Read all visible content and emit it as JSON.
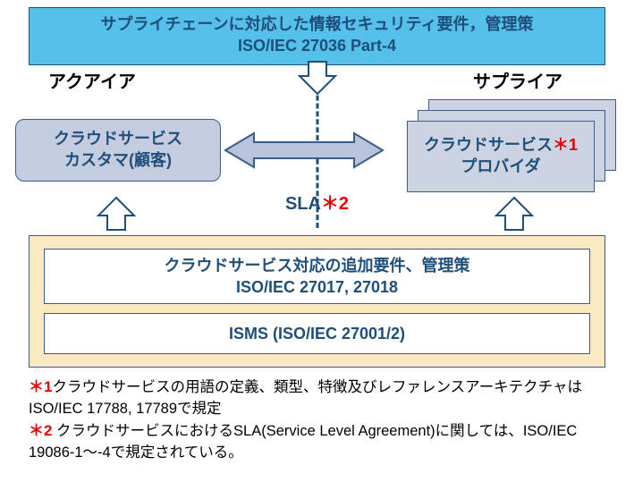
{
  "top": {
    "line1": "サプライチェーンに対応した情報セキュリティ要件，管理策",
    "line2": "ISO/IEC 27036 Part-4"
  },
  "roles": {
    "acquirer": "アクアイア",
    "supplier": "サプライア"
  },
  "customer": {
    "line1": "クラウドサービス",
    "line2": "カスタマ(顧客)"
  },
  "provider": {
    "line1_pre": "クラウドサービス",
    "ast1": "＊1",
    "line2": "プロバイダ"
  },
  "sla": {
    "label": "SLA",
    "ast2": "＊2"
  },
  "bottom": {
    "box1_line1": "クラウドサービス対応の追加要件、管理策",
    "box1_line2": "ISO/IEC 27017, 27018",
    "box2": "ISMS (ISO/IEC 27001/2)"
  },
  "footnotes": {
    "n1_marker": "＊1",
    "n1_text": "クラウドサービスの用語の定義、類型、特徴及びレファレンスアーキテクチャはISO/IEC 17788, 17789で規定",
    "n2_marker": "＊2",
    "n2_text": " クラウドサービスにおけるSLA(Service Level Agreement)に関しては、ISO/IEC 19086-1～-4で規定されている。"
  },
  "colors": {
    "top_bg": "#55c1ea",
    "border": "#1f4e79",
    "box_bg": "#c4cde0",
    "panel_bg": "#fbe9c4",
    "arrow_fill": "#b8c4dc",
    "red": "#e60000"
  }
}
